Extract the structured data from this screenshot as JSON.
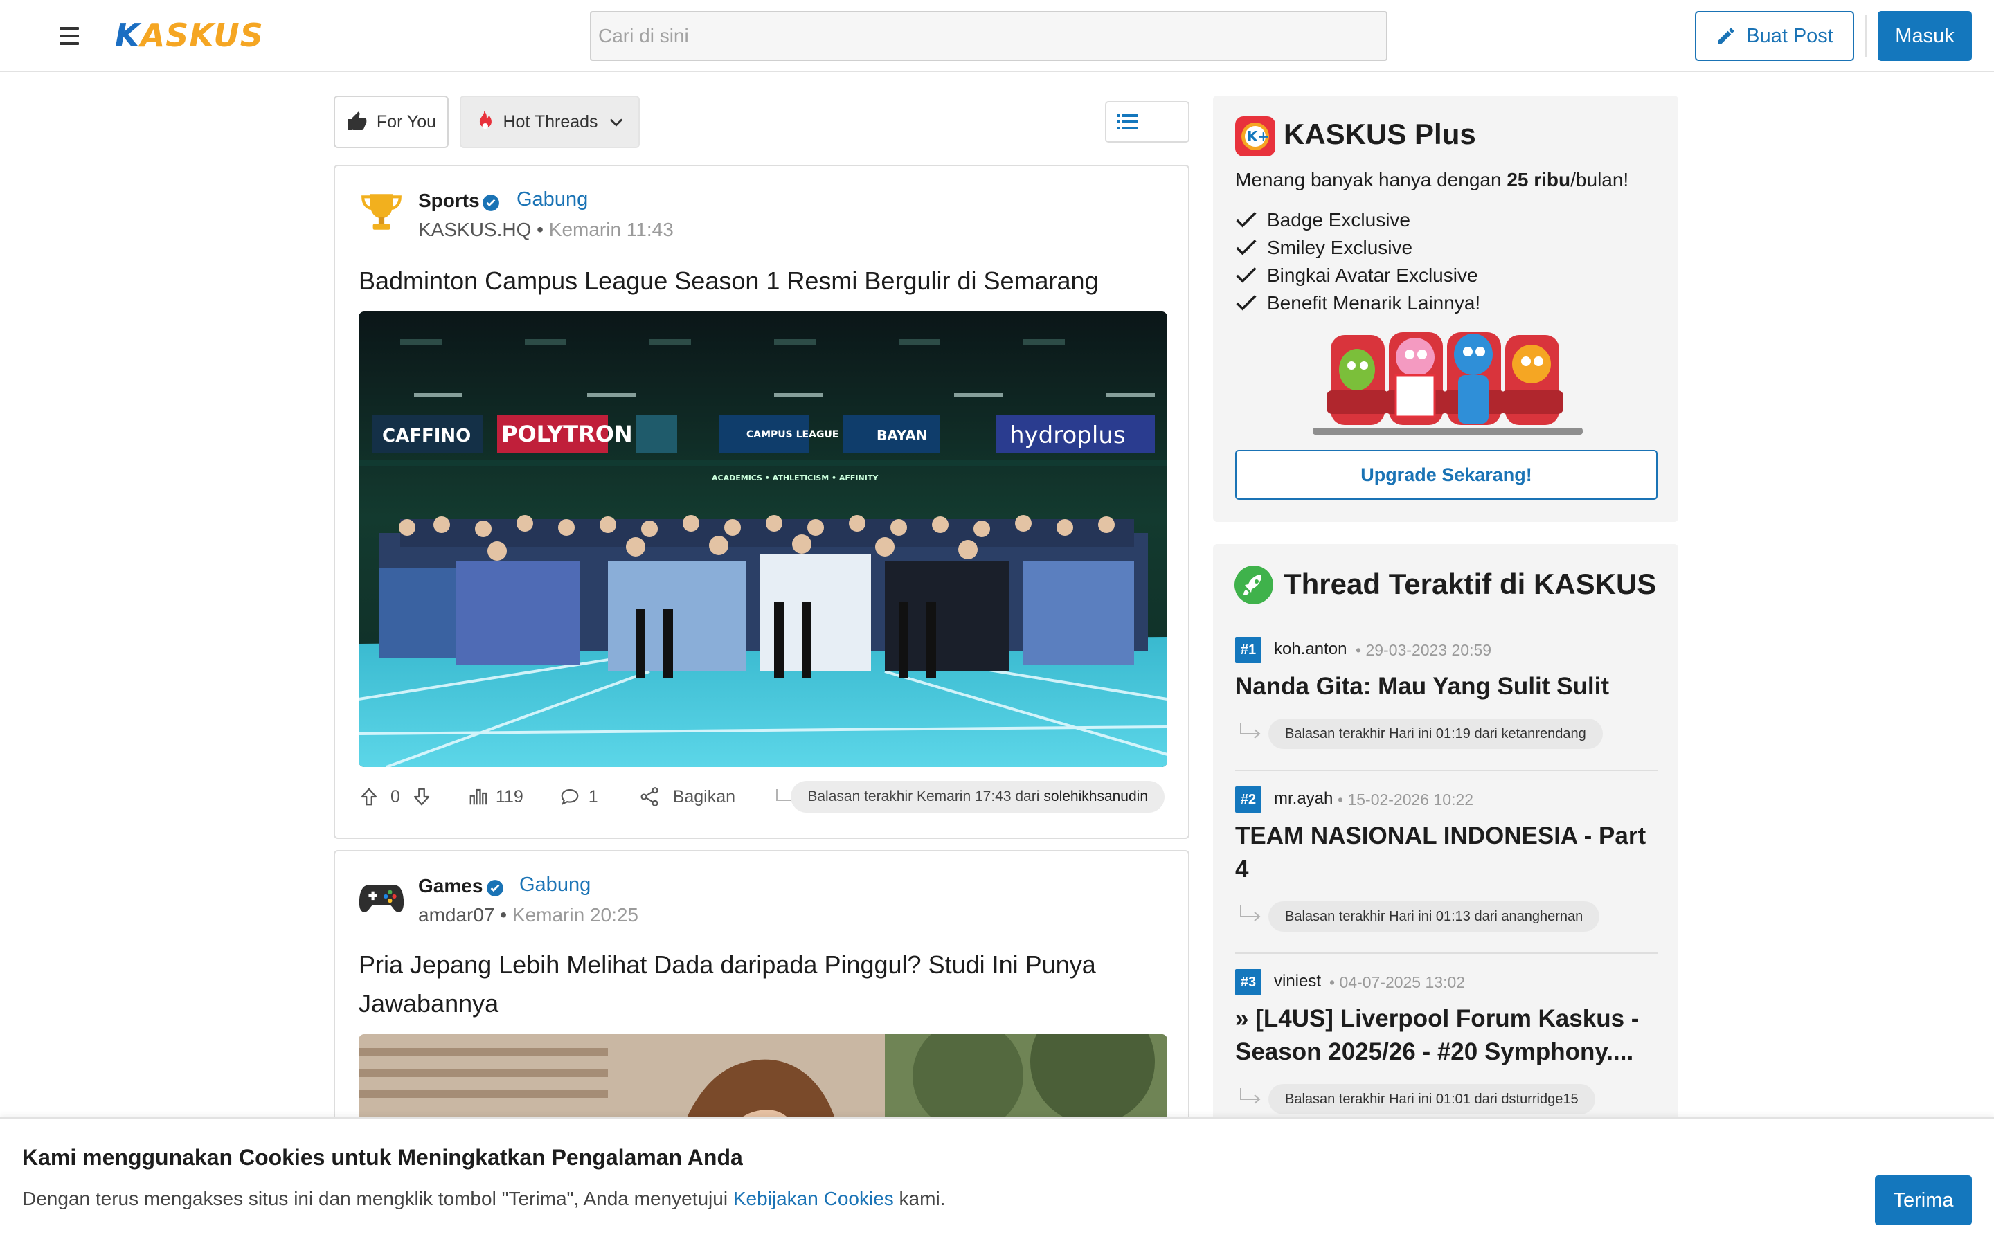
{
  "header": {
    "logo_k": "K",
    "logo_rest": "ASKUS",
    "search_placeholder": "Cari di sini",
    "buat_post_label": "Buat Post",
    "masuk_label": "Masuk"
  },
  "tabs": {
    "for_you": "For You",
    "hot_threads": "Hot Threads"
  },
  "threads": [
    {
      "category": "Sports",
      "join_label": "Gabung",
      "author": "KASKUS.HQ",
      "separator": " • ",
      "time": "Kemarin 11:43",
      "title": "Badminton Campus League Season 1 Resmi Bergulir di Semarang",
      "image_banners": [
        "CAFFINO",
        "POLYTRON",
        "CAMPUS LEAGUE",
        "BAYAN",
        "hydroplus"
      ],
      "banner_sub": "ACADEMICS • ATHLETICISM • AFFINITY",
      "upvotes": "0",
      "views": "119",
      "comments": "1",
      "share_label": "Bagikan",
      "last_reply_prefix": "Balasan terakhir Kemarin 17:43 dari",
      "last_reply_user": "solehikhsanudin"
    },
    {
      "category": "Games",
      "join_label": "Gabung",
      "author": "amdar07",
      "separator": " • ",
      "time": "Kemarin 20:25",
      "title": "Pria Jepang Lebih Melihat Dada daripada Pinggul? Studi Ini Punya Jawabannya"
    }
  ],
  "kaskus_plus": {
    "title": "KASKUS Plus",
    "subtitle_pre": "Menang banyak hanya dengan ",
    "subtitle_bold": "25 ribu",
    "subtitle_post": "/bulan!",
    "benefits": [
      "Badge Exclusive",
      "Smiley Exclusive",
      "Bingkai Avatar Exclusive",
      "Benefit Menarik Lainnya!"
    ],
    "upgrade_label": "Upgrade Sekarang!"
  },
  "active_threads": {
    "title": "Thread Teraktif di KASKUS",
    "items": [
      {
        "rank": "#1",
        "user": "koh.anton",
        "date": "29-03-2023 20:59",
        "title": "Nanda Gita: Mau Yang Sulit Sulit",
        "reply": "Balasan terakhir Hari ini 01:19 dari ketanrendang"
      },
      {
        "rank": "#2",
        "user": "mr.ayah",
        "date": "15-02-2026 10:22",
        "title": "TEAM NASIONAL INDONESIA - Part 4",
        "reply": "Balasan terakhir Hari ini 01:13 dari ananghernan"
      },
      {
        "rank": "#3",
        "user": "viniest",
        "date": "04-07-2025 13:02",
        "title": "» [L4US] Liverpool Forum Kaskus - Season 2025/26 - #20 Symphony....",
        "reply": "Balasan terakhir Hari ini 01:01 dari dsturridge15"
      }
    ]
  },
  "cookie": {
    "title": "Kami menggunakan Cookies untuk Meningkatkan Pengalaman Anda",
    "text_pre": "Dengan terus mengakses situs ini dan mengklik tombol \"Terima\", Anda menyetujui ",
    "link": "Kebijakan Cookies",
    "text_post": " kami.",
    "accept_label": "Terima"
  },
  "colors": {
    "brand_blue": "#1477bd",
    "brand_orange": "#f5a623",
    "link_blue": "#1a73b5"
  },
  "icons": [
    "menu-icon",
    "pencil-icon",
    "thumbs-up-icon",
    "fire-icon",
    "chevron-down-icon",
    "card-view-icon",
    "list-view-icon",
    "trophy-icon",
    "gamepad-icon",
    "verified-icon",
    "upvote-icon",
    "downvote-icon",
    "views-icon",
    "comment-icon",
    "share-icon",
    "reply-arrow-icon",
    "check-icon",
    "kaskus-plus-logo",
    "rocket-icon"
  ]
}
